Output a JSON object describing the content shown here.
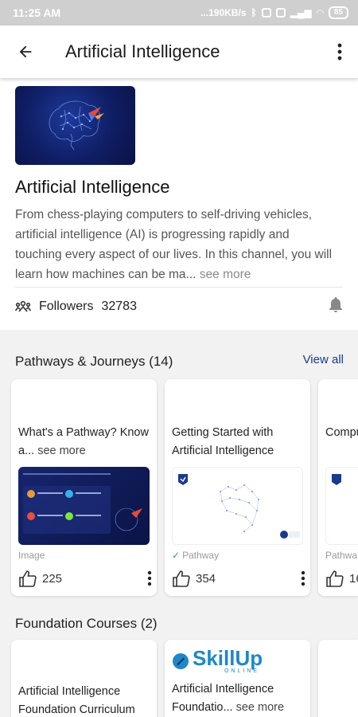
{
  "status_bar": {
    "time": "11:25 AM",
    "network": "...190KB/s",
    "battery": "85"
  },
  "app_bar": {
    "title": "Artificial Intelligence"
  },
  "channel": {
    "title": "Artificial Intelligence",
    "description": "From chess-playing computers to self-driving vehicles, artificial intelligence (AI) is progressing rapidly and touching every aspect of our lives. In this channel, you will learn how machines can be ma...",
    "see_more": "see more",
    "followers_label": "Followers",
    "followers_count": "32783"
  },
  "pathways": {
    "heading": "Pathways & Journeys (14)",
    "view_all": "View all",
    "cards": [
      {
        "title": "What's a Pathway? Know a...",
        "see_more": "see more",
        "type": "Image",
        "likes": "225"
      },
      {
        "title": "Getting Started with Artificial Intelligence",
        "see_more": "",
        "type": "Pathway",
        "likes": "354"
      },
      {
        "title": "Compu",
        "see_more": "",
        "type": "Pathwa",
        "likes": "16"
      }
    ]
  },
  "foundation": {
    "heading": "Foundation Courses (2)",
    "cards": [
      {
        "title": "Artificial Intelligence Foundation Curriculum",
        "see_more": ""
      },
      {
        "logo_text": "SkillUp",
        "logo_sub": "ONLINE",
        "title": "Artificial Intelligence Foundatio...",
        "see_more": "see more"
      }
    ]
  },
  "colors": {
    "accent": "#1a3a8a",
    "thumb_bg": "#0f1d63",
    "logo_blue": "#1e88c8"
  }
}
